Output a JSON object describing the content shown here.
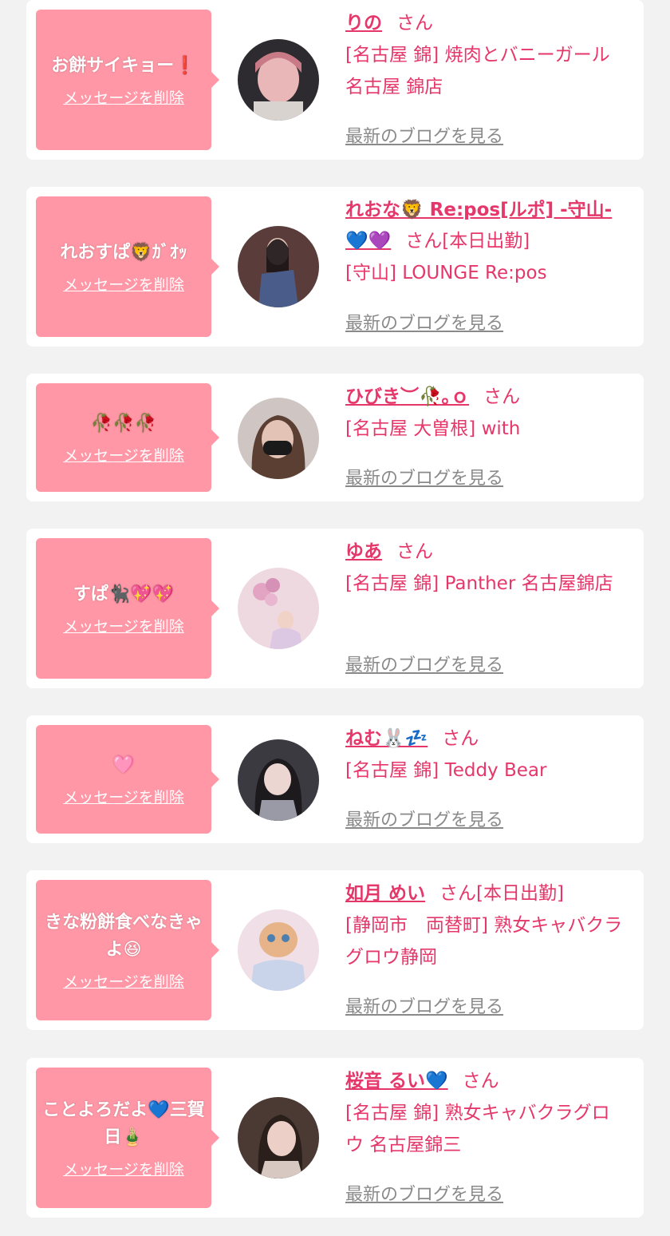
{
  "delete_label": "メッセージを削除",
  "blog_label": "最新のブログを見る",
  "honorific": "さん",
  "entries": [
    {
      "message": "お餅サイキョー❗️",
      "name": "りの",
      "status": "",
      "shop": "[名古屋 錦] 焼肉とバニーガール 名古屋 錦店"
    },
    {
      "message": "れおすぱ🦁ｶﾞｵｯ",
      "name": "れおな🦁 Re:pos[ルポ] -守山-💙💜",
      "status": "[本日出勤]",
      "shop": "[守山] LOUNGE Re:pos"
    },
    {
      "message": "🥀🥀🥀",
      "name": "ひびき︶🥀｡ｏ",
      "status": "",
      "shop": "[名古屋 大曽根] with"
    },
    {
      "message": "すぱ🐈‍⬛💖💖",
      "name": "ゆあ",
      "status": "",
      "shop": "[名古屋 錦] Panther 名古屋錦店"
    },
    {
      "message": "🩷",
      "name": "ねむ🐰💤",
      "status": "",
      "shop": "[名古屋 錦] Teddy Bear"
    },
    {
      "message": "きな粉餅食べなきゃよ😆",
      "name": "如月 めい",
      "status": "[本日出勤]",
      "shop": "[静岡市　両替町] 熟女キャバクラ グロウ静岡"
    },
    {
      "message": "ことよろだよ💙三賀日🎍",
      "name": "桜音 るい💙",
      "status": "",
      "shop": "[名古屋 錦] 熟女キャバクラグロウ 名古屋錦三"
    }
  ]
}
